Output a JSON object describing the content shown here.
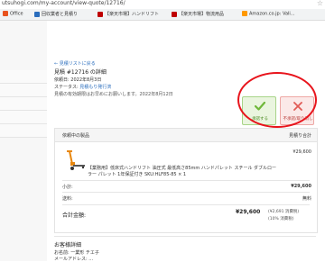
{
  "browser": {
    "url": "utsuhogi.com/my-account/view-quote/12716/"
  },
  "bookmarks": [
    {
      "label": "Office",
      "color": "#e8531f"
    },
    {
      "label": "回収業者と見積り",
      "color": "#2a6dbd"
    },
    {
      "label": "【楽天市場】ハンドリフト",
      "color": "#bf0000"
    },
    {
      "label": "【楽天市場】物流用品",
      "color": "#bf0000"
    },
    {
      "label": "Amazon.co.jp: Vali...",
      "color": "#ff9900"
    }
  ],
  "quote": {
    "back_link": "← 見積リストに戻る",
    "title": "見積 #12716 の詳細",
    "request_date": "依頼日: 2022年8月3日",
    "status_label": "ステータス:",
    "status_value": "見積もり発行済",
    "validity_note": "見積の有効期限はお早めにお願いします。2022年8月12日",
    "accept_label": "承諾する",
    "reject_label": "不承諾/取り消し",
    "table_header_product": "依頼中の製品",
    "table_header_subtotal": "見積り合計",
    "product_name": "【業務用】低床式ハンドリフト 油圧式 最低高さ85mm ハンドパレット スチール ダブルローラー パレット 1年保証付き SKU:HLF85-85 × 1",
    "product_price": "¥29,600",
    "subtotal_label": "小計:",
    "subtotal_value": "¥29,600",
    "shipping_label": "送料:",
    "shipping_value": "無料",
    "total_label": "合計金額:",
    "total_value": "¥29,600",
    "tax_note": "(¥2,691 消費税)",
    "tax_rate": "(10% 消費税)"
  },
  "customer": {
    "section_title": "お客様詳細",
    "name": "お名前: 一業形 チエ子",
    "email": "メールアドレス: ..."
  },
  "colors": {
    "accept": "#6fb83a",
    "reject": "#e15a55",
    "annotation": "#e8141c",
    "link": "#2a6dbd"
  }
}
